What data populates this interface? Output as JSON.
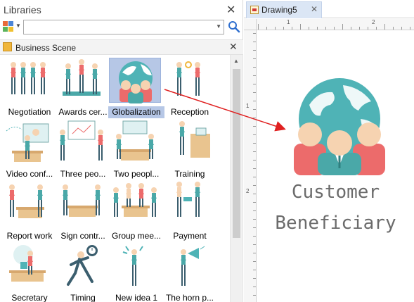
{
  "libraries": {
    "title": "Libraries",
    "category": "Business Scene",
    "search_value": ""
  },
  "shapes": [
    {
      "label": "Negotiation",
      "icon": "negotiation-icon",
      "selected": false
    },
    {
      "label": "Awards cer...",
      "icon": "awards-icon",
      "selected": false
    },
    {
      "label": "Globalization",
      "icon": "globalization-icon",
      "selected": true
    },
    {
      "label": "Reception",
      "icon": "reception-icon",
      "selected": false
    },
    {
      "label": "Video conf...",
      "icon": "video-conference-icon",
      "selected": false
    },
    {
      "label": "Three peo...",
      "icon": "three-people-icon",
      "selected": false
    },
    {
      "label": "Two peopl...",
      "icon": "two-people-icon",
      "selected": false
    },
    {
      "label": "Training",
      "icon": "training-icon",
      "selected": false
    },
    {
      "label": "Report work",
      "icon": "report-work-icon",
      "selected": false
    },
    {
      "label": "Sign contr...",
      "icon": "sign-contract-icon",
      "selected": false
    },
    {
      "label": "Group mee...",
      "icon": "group-meeting-icon",
      "selected": false
    },
    {
      "label": "Payment",
      "icon": "payment-icon",
      "selected": false
    },
    {
      "label": "Secretary",
      "icon": "secretary-icon",
      "selected": false
    },
    {
      "label": "Timing",
      "icon": "timing-icon",
      "selected": false
    },
    {
      "label": "New idea 1",
      "icon": "new-idea-icon",
      "selected": false
    },
    {
      "label": "The horn p...",
      "icon": "horn-icon",
      "selected": false
    }
  ],
  "drawing": {
    "tab_label": "Drawing5",
    "ruler_h": [
      "1",
      "2"
    ],
    "ruler_v": [
      "1",
      "2"
    ],
    "text_line1": "Customer",
    "text_line2": "Beneficiary"
  },
  "colors": {
    "selection": "#b6c7e6",
    "globe": "#4fb3b6",
    "skin": "#f6d3b1",
    "shirt_red": "#ec6b6b",
    "shirt_teal": "#4aa8a8",
    "arrow": "#e02020"
  }
}
